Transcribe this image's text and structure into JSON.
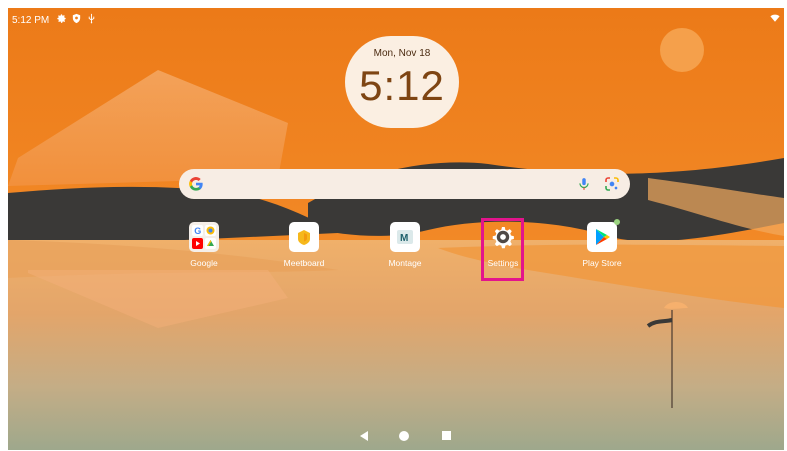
{
  "status_bar": {
    "time": "5:12 PM",
    "icons": [
      "gear-icon",
      "shield-icon",
      "usb-icon"
    ],
    "right_icons": [
      "wifi-icon"
    ]
  },
  "clock_widget": {
    "date": "Mon, Nov 18",
    "time": "5:12"
  },
  "search_bar": {
    "icons": [
      "google-g-icon",
      "microphone-icon",
      "google-lens-icon"
    ]
  },
  "apps": [
    {
      "label": "Google",
      "icon": "google-folder-icon"
    },
    {
      "label": "Meetboard",
      "icon": "meetboard-icon"
    },
    {
      "label": "Montage",
      "icon": "montage-icon"
    },
    {
      "label": "Settings",
      "icon": "gear-icon"
    },
    {
      "label": "Play Store",
      "icon": "play-store-icon"
    }
  ],
  "montage_letter": "M",
  "highlight": {
    "target": "Settings",
    "color": "#e3148c"
  },
  "nav_bar": {
    "buttons": [
      "back-icon",
      "home-icon",
      "recents-icon"
    ]
  },
  "colors": {
    "sky_top": "#ee7f1b",
    "sky_bottom": "#f6a35a",
    "sun": "#f5a04b",
    "dunes": "#3a3937",
    "water": "#a9a98a",
    "clock_bg": "#fbefe2",
    "search_bg": "#f7ede4"
  }
}
